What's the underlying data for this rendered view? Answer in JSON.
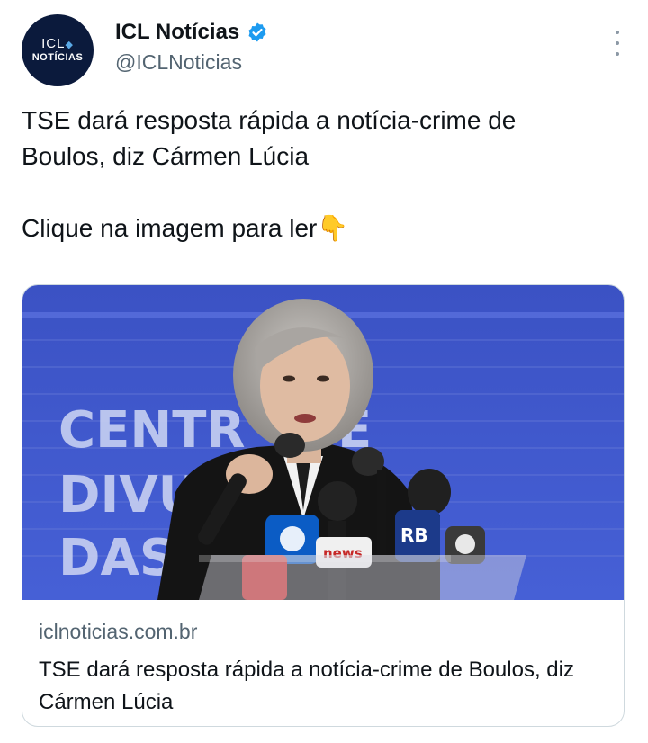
{
  "author": {
    "avatar_line1": "ICL",
    "avatar_line2": "NOTÍCIAS",
    "display_name": "ICL Notícias",
    "handle": "@ICLNoticias",
    "verified_icon": "verified-badge-icon"
  },
  "tweet": {
    "text": "TSE dará resposta rápida a notícia-crime de\nBoulos, diz Cármen Lúcia\n\nClique na imagem para ler👇"
  },
  "card": {
    "domain": "iclnoticias.com.br",
    "title": "TSE dará resposta rápida a notícia-crime de Boulos, diz Cármen Lúcia",
    "backdrop_text": [
      "CENTR",
      "E",
      "DIVU",
      "DAS"
    ],
    "mic_labels": [
      "news",
      "RB"
    ]
  },
  "colors": {
    "accent": "#1d9bf0",
    "avatar_bg": "#0b1a3c",
    "backdrop_blue": "#3f56c8",
    "secondary_text": "#536471"
  }
}
